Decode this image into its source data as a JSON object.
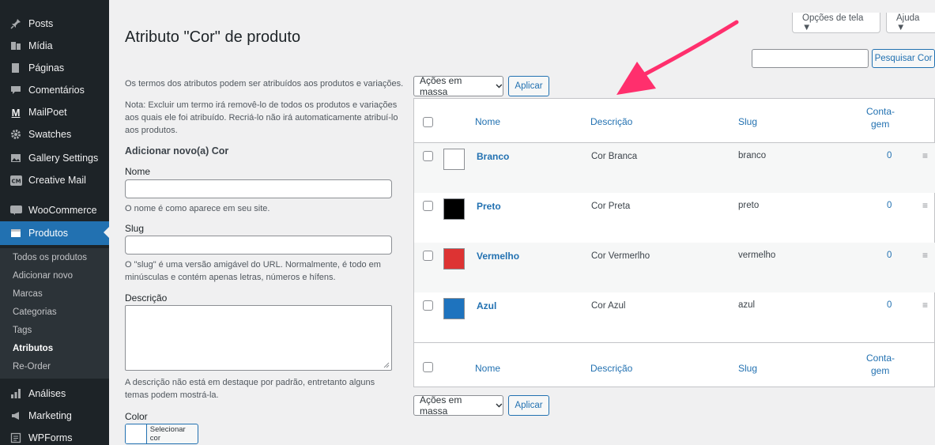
{
  "sidebar": {
    "items": [
      {
        "label": "Posts",
        "icon": "pin-icon"
      },
      {
        "label": "Mídia",
        "icon": "media-icon"
      },
      {
        "label": "Páginas",
        "icon": "page-icon"
      },
      {
        "label": "Comentários",
        "icon": "comment-icon"
      },
      {
        "label": "MailPoet",
        "icon": "mailpoet-icon"
      },
      {
        "label": "Swatches",
        "icon": "gear-icon"
      },
      {
        "label": "Gallery Settings",
        "icon": "gallery-icon"
      },
      {
        "label": "Creative Mail",
        "icon": "creative-mail-icon"
      },
      {
        "label": "WooCommerce",
        "icon": "woocommerce-icon"
      },
      {
        "label": "Produtos",
        "icon": "products-icon"
      },
      {
        "label": "Análises",
        "icon": "analytics-icon"
      },
      {
        "label": "Marketing",
        "icon": "megaphone-icon"
      },
      {
        "label": "WPForms",
        "icon": "forms-icon"
      }
    ],
    "submenu": [
      "Todos os produtos",
      "Adicionar novo",
      "Marcas",
      "Categorias",
      "Tags",
      "Atributos",
      "Re-Order"
    ]
  },
  "top": {
    "screen_options": "Opções de tela ▼",
    "help": "Ajuda ▼"
  },
  "page": {
    "title": "Atributo \"Cor\" de produto"
  },
  "form": {
    "intro": "Os termos dos atributos podem ser atribuídos aos produtos e variações.",
    "note_line1": "Nota: Excluir um termo irá removê-lo de todos os produtos e variações",
    "note_line2": "aos quais ele foi atribuído. Recriá-lo não irá automaticamente atribuí-lo",
    "note_line3": "aos produtos.",
    "heading": "Adicionar novo(a) Cor",
    "name_label": "Nome",
    "name_help": "O nome é como aparece em seu site.",
    "slug_label": "Slug",
    "slug_help_line1": "O \"slug\" é uma versão amigável do URL. Normalmente, é todo em",
    "slug_help_line2": "minúsculas e contém apenas letras, números e hífens.",
    "desc_label": "Descrição",
    "desc_help_line1": "A descrição não está em destaque por padrão, entretanto alguns",
    "desc_help_line2": "temas podem mostrá-la.",
    "color_label": "Color",
    "color_button": "Selecionar cor"
  },
  "search": {
    "button": "Pesquisar Cor"
  },
  "bulk": {
    "select": "Ações em massa",
    "apply": "Aplicar"
  },
  "table": {
    "headers": {
      "name": "Nome",
      "description": "Descrição",
      "slug": "Slug",
      "count_line1": "Conta-",
      "count_line2": "gem"
    },
    "rows": [
      {
        "name": "Branco",
        "description": "Cor Branca",
        "slug": "branco",
        "count": "0",
        "color": "#ffffff"
      },
      {
        "name": "Preto",
        "description": "Cor Preta",
        "slug": "preto",
        "count": "0",
        "color": "#000000"
      },
      {
        "name": "Vermelho",
        "description": "Cor Vermerlho",
        "slug": "vermelho",
        "count": "0",
        "color": "#dd3333"
      },
      {
        "name": "Azul",
        "description": "Cor Azul",
        "slug": "azul",
        "count": "0",
        "color": "#1e73be"
      }
    ]
  },
  "colors": {
    "accent": "#2271b1",
    "sidebar": "#1d2327",
    "arrow": "#ff2f6d"
  }
}
